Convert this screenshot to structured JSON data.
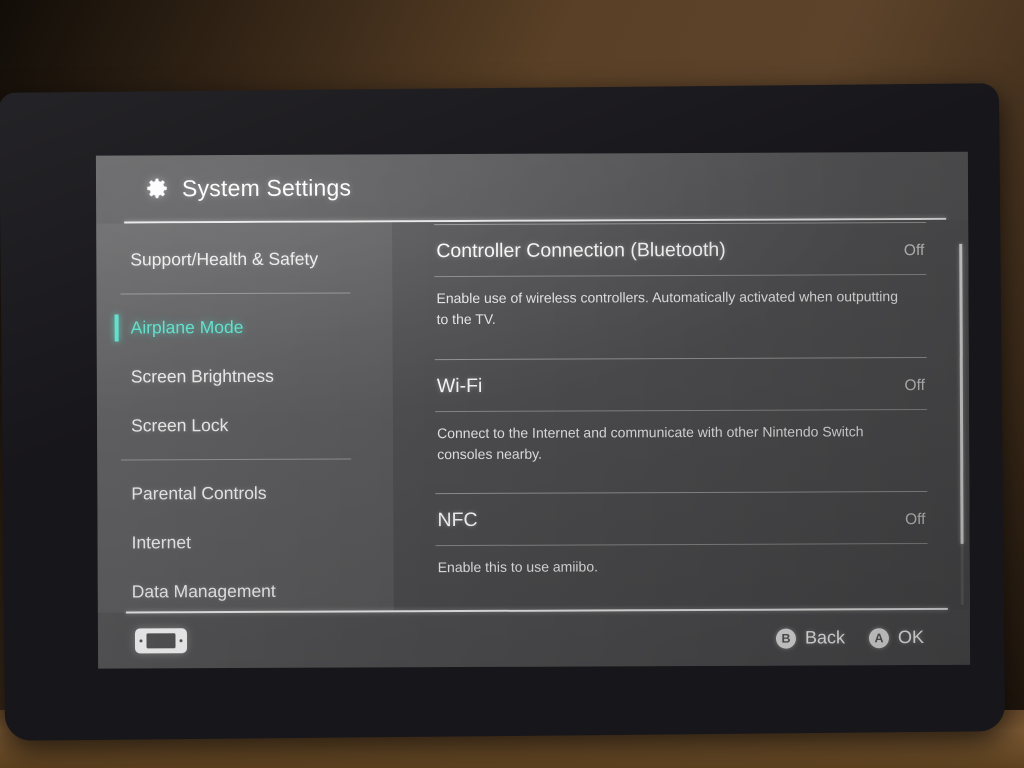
{
  "device": {
    "name": "nintendo-switch-handheld",
    "bezel_color": "#17161a",
    "ambient_color": "#5a4026"
  },
  "header": {
    "icon": "gear-icon",
    "title": "System Settings"
  },
  "sidebar": {
    "groups": [
      {
        "items": [
          {
            "label": "Support/Health & Safety",
            "selected": false
          }
        ]
      },
      {
        "items": [
          {
            "label": "Airplane Mode",
            "selected": true
          },
          {
            "label": "Screen Brightness",
            "selected": false
          },
          {
            "label": "Screen Lock",
            "selected": false
          }
        ]
      },
      {
        "items": [
          {
            "label": "Parental Controls",
            "selected": false
          },
          {
            "label": "Internet",
            "selected": false
          },
          {
            "label": "Data Management",
            "selected": false
          }
        ]
      }
    ],
    "selected_color": "#4fe8cf"
  },
  "content": {
    "rows": [
      {
        "title": "Controller Connection (Bluetooth)",
        "value": "Off",
        "description": "Enable use of wireless controllers. Automatically activated when outputting to the TV."
      },
      {
        "title": "Wi-Fi",
        "value": "Off",
        "description": "Connect to the Internet and communicate with other Nintendo Switch consoles nearby."
      },
      {
        "title": "NFC",
        "value": "Off",
        "description": "Enable this to use amiibo."
      }
    ]
  },
  "footer": {
    "console_icon": "switch-console-icon",
    "hints": [
      {
        "button": "B",
        "label": "Back"
      },
      {
        "button": "A",
        "label": "OK"
      }
    ]
  }
}
